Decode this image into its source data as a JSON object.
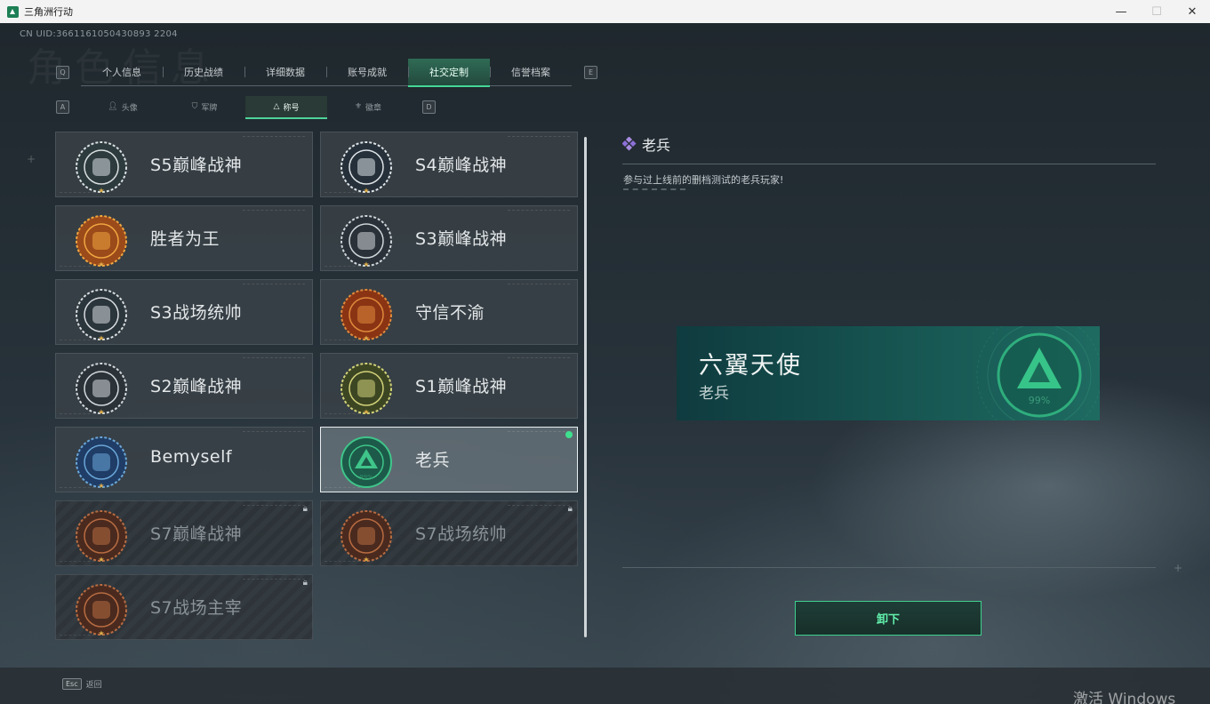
{
  "window": {
    "title": "三角洲行动",
    "minimize": "—",
    "maximize": "☐",
    "close": "✕"
  },
  "uid_text": "CN UID:3661161050430893 2204",
  "bg_heading": "角色信息",
  "main_tabs": [
    "个人信息",
    "历史战绩",
    "详细数据",
    "账号成就",
    "社交定制",
    "信誉档案"
  ],
  "main_tabs_active": "社交定制",
  "keyhints": {
    "q": "Q",
    "e": "E",
    "a": "A",
    "d": "D"
  },
  "sub_tabs": [
    "头像",
    "军牌",
    "称号",
    "徽章"
  ],
  "sub_tabs_active": "称号",
  "titles": [
    {
      "label": "S5巅峰战神",
      "locked": false,
      "selected": false,
      "medal": "skull-soldier"
    },
    {
      "label": "S4巅峰战神",
      "locked": false,
      "selected": false,
      "medal": "helmet-goggles"
    },
    {
      "label": "胜者为王",
      "locked": false,
      "selected": false,
      "medal": "gold-medal"
    },
    {
      "label": "S3巅峰战神",
      "locked": false,
      "selected": false,
      "medal": "globe-eagle"
    },
    {
      "label": "S3战场统帅",
      "locked": false,
      "selected": false,
      "medal": "tank"
    },
    {
      "label": "守信不渝",
      "locked": false,
      "selected": false,
      "medal": "scales"
    },
    {
      "label": "S2巅峰战神",
      "locked": false,
      "selected": false,
      "medal": "triangle-shield"
    },
    {
      "label": "S1巅峰战神",
      "locked": false,
      "selected": false,
      "medal": "crocodile"
    },
    {
      "label": "Bemyself",
      "locked": false,
      "selected": false,
      "medal": "blue-helmet-signature"
    },
    {
      "label": "老兵",
      "locked": false,
      "selected": true,
      "medal": "delta-logo",
      "medal_text": "99%"
    },
    {
      "label": "S7巅峰战神",
      "locked": true,
      "selected": false,
      "medal": "rifle"
    },
    {
      "label": "S7战场统帅",
      "locked": true,
      "selected": false,
      "medal": "vehicle"
    },
    {
      "label": "S7战场主宰",
      "locked": true,
      "selected": false,
      "medal": "warrior-face"
    }
  ],
  "detail": {
    "title": "老兵",
    "description": "参与过上线前的删档测试的老兵玩家!",
    "banner_name": "六翼天使",
    "banner_title": "老兵",
    "banner_percent": "99%",
    "unequip_label": "卸下"
  },
  "footer": {
    "esc_key": "Esc",
    "back_label": "返回"
  },
  "watermark": "激活 Windows",
  "colors": {
    "accent": "#44d795",
    "banner": "#175652",
    "selected_border": "#e8eef0"
  }
}
